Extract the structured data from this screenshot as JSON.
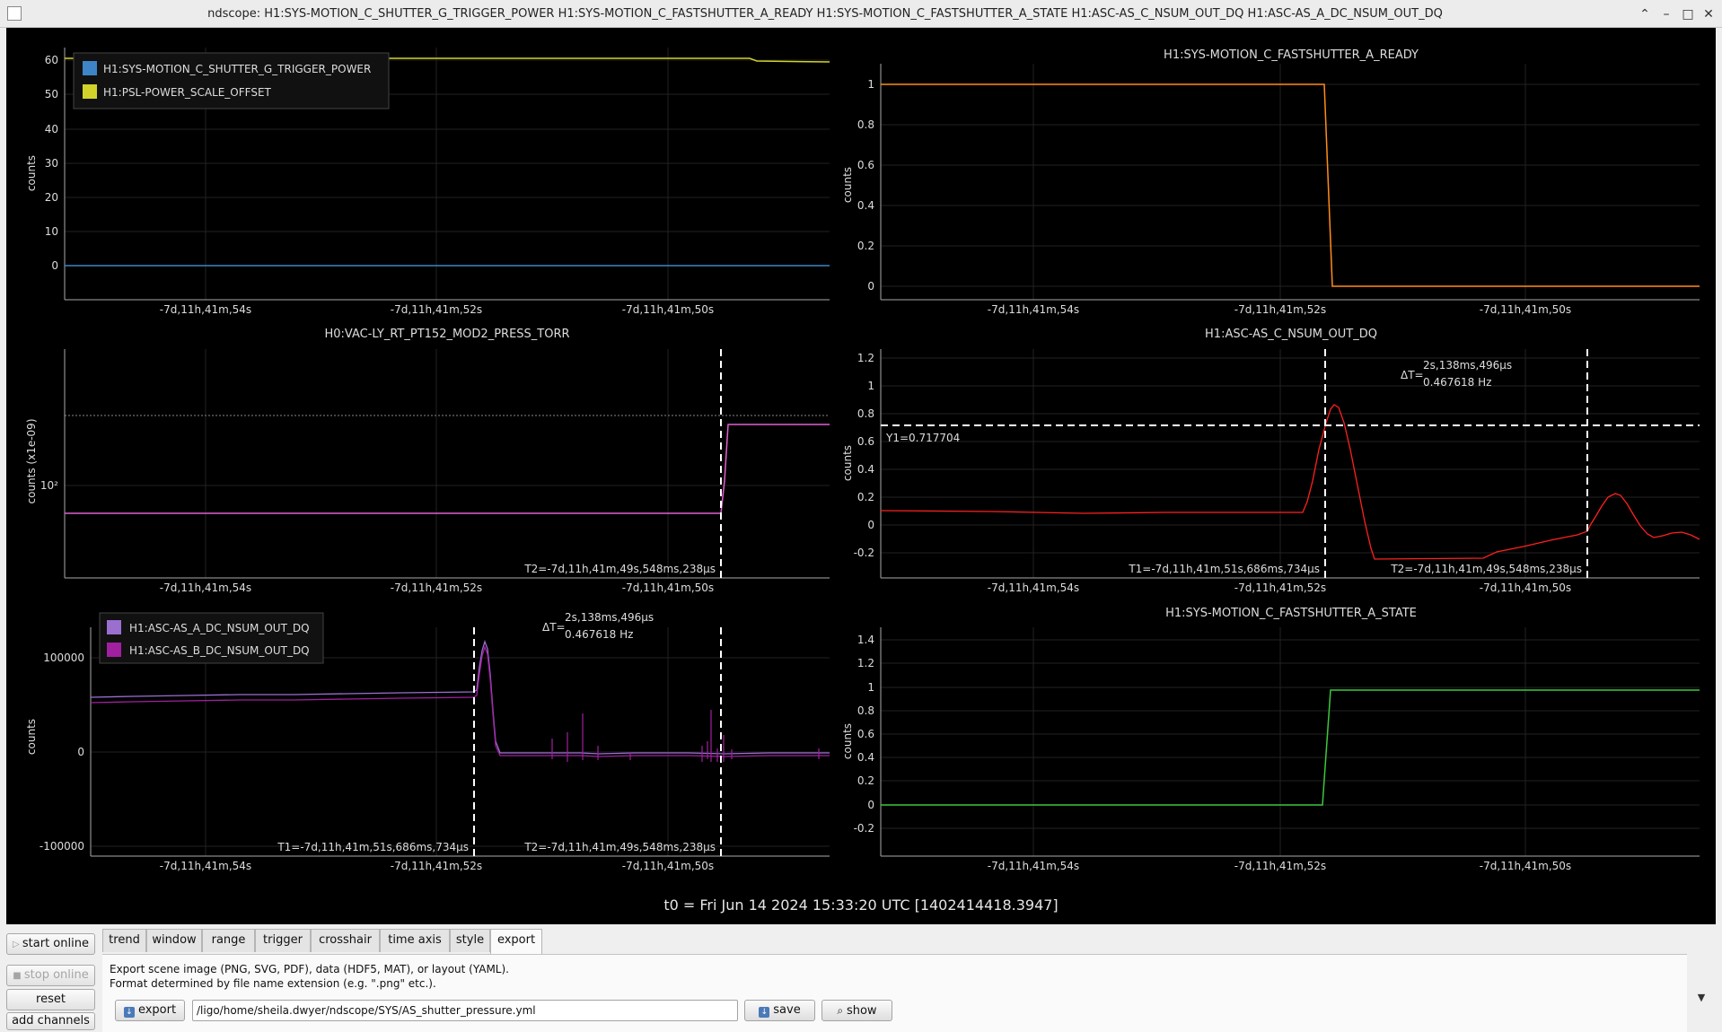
{
  "window": {
    "title": "ndscope: H1:SYS-MOTION_C_SHUTTER_G_TRIGGER_POWER H1:SYS-MOTION_C_FASTSHUTTER_A_READY H1:SYS-MOTION_C_FASTSHUTTER_A_STATE H1:ASC-AS_C_NSUM_OUT_DQ H1:ASC-AS_A_DC_NSUM_OUT_DQ",
    "minimize": "–",
    "maximize": "□",
    "close": "✕",
    "restore": "⌃"
  },
  "time_ticks": [
    "-7d,11h,41m,54s",
    "-7d,11h,41m,52s",
    "-7d,11h,41m,50s"
  ],
  "t0": "t0 = Fri Jun 14 2024 15:33:20 UTC [1402414418.3947]",
  "colors": {
    "blue": "#3d85c6",
    "yellow": "#d2d22a",
    "orange": "#ff8c1a",
    "pink": "#e060d0",
    "red": "#ff2020",
    "green": "#3cc83c",
    "lavender": "#9a6fd0",
    "purple": "#a020a0"
  },
  "plots": {
    "p1": {
      "ylabel": "counts",
      "yticks": [
        "60",
        "50",
        "40",
        "30",
        "20",
        "10",
        "0"
      ],
      "legend": [
        "H1:SYS-MOTION_C_SHUTTER_G_TRIGGER_POWER",
        "H1:PSL-POWER_SCALE_OFFSET"
      ]
    },
    "p2": {
      "title": "H1:SYS-MOTION_C_FASTSHUTTER_A_READY",
      "ylabel": "counts",
      "yticks": [
        "1",
        "0.8",
        "0.6",
        "0.4",
        "0.2",
        "0"
      ]
    },
    "p3": {
      "title": "H0:VAC-LY_RT_PT152_MOD2_PRESS_TORR",
      "ylabel": "counts (x1e-09)",
      "ytick": "10²",
      "t2": "T2=-7d,11h,41m,49s,548ms,238μs"
    },
    "p4": {
      "title": "H1:ASC-AS_C_NSUM_OUT_DQ",
      "ylabel": "counts",
      "yticks": [
        "1.2",
        "1",
        "0.8",
        "0.6",
        "0.4",
        "0.2",
        "0",
        "-0.2"
      ],
      "y1": "Y1=0.717704",
      "dt_label": "ΔT=",
      "dt": "2s,138ms,496μs",
      "freq": "0.467618 Hz",
      "t1": "T1=-7d,11h,41m,51s,686ms,734μs",
      "t2": "T2=-7d,11h,41m,49s,548ms,238μs"
    },
    "p5": {
      "ylabel": "counts",
      "yticks": [
        "100000",
        "0",
        "-100000"
      ],
      "legend": [
        "H1:ASC-AS_A_DC_NSUM_OUT_DQ",
        "H1:ASC-AS_B_DC_NSUM_OUT_DQ"
      ],
      "dt_label": "ΔT=",
      "dt": "2s,138ms,496μs",
      "freq": "0.467618 Hz",
      "t1": "T1=-7d,11h,41m,51s,686ms,734μs",
      "t2": "T2=-7d,11h,41m,49s,548ms,238μs"
    },
    "p6": {
      "title": "H1:SYS-MOTION_C_FASTSHUTTER_A_STATE",
      "ylabel": "counts",
      "yticks": [
        "1.4",
        "1.2",
        "1",
        "0.8",
        "0.6",
        "0.4",
        "0.2",
        "0",
        "-0.2"
      ]
    }
  },
  "side_buttons": {
    "start_online": "start online",
    "stop_online": "stop online",
    "reset": "reset",
    "add_channels": "add channels"
  },
  "tabs": [
    "trend",
    "window",
    "range",
    "trigger",
    "crosshair",
    "time axis",
    "style",
    "export"
  ],
  "active_tab": "export",
  "export_pane": {
    "help_line1": "Export scene image (PNG, SVG, PDF), data (HDF5, MAT), or layout (YAML).",
    "help_line2": "Format determined by file name extension (e.g. \".png\" etc.).",
    "export_button": "export",
    "path": "/ligo/home/sheila.dwyer/ndscope/SYS/AS_shutter_pressure.yml",
    "save_button": "save",
    "show_button": "show"
  }
}
